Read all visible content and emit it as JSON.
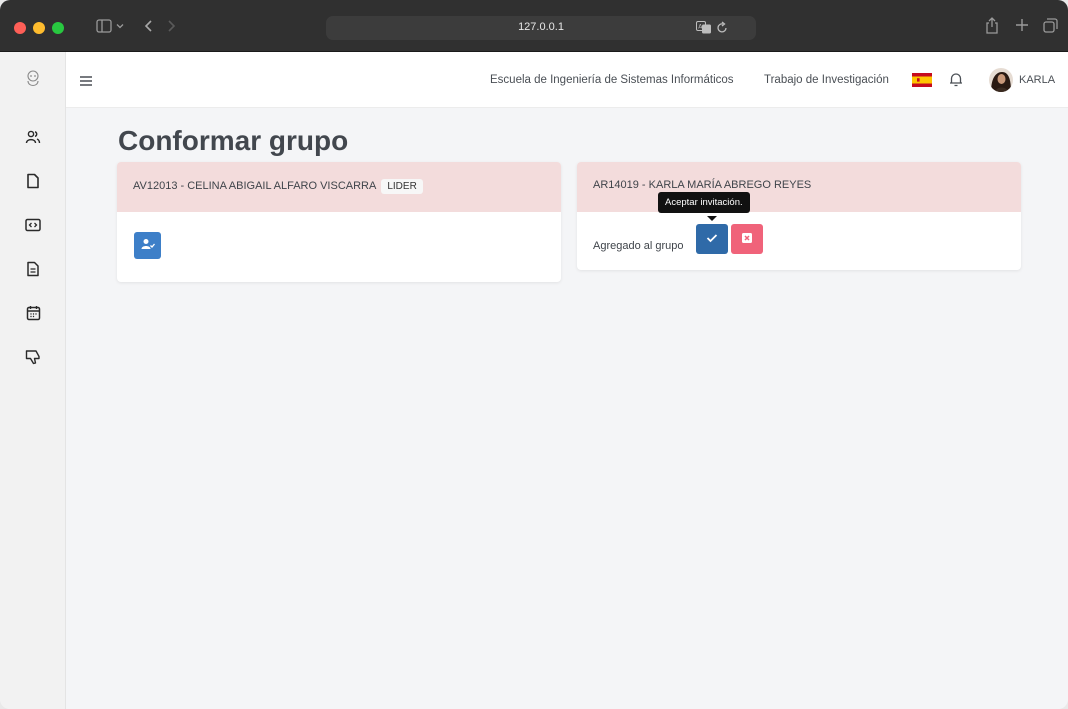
{
  "browser": {
    "url": "127.0.0.1"
  },
  "nav": {
    "links": [
      "Escuela de Ingeniería de Sistemas Informáticos",
      "Trabajo de Investigación"
    ],
    "user_name": "KARLA",
    "language_flag": "spain-flag-icon"
  },
  "sidebar": {
    "items": [
      "users-icon",
      "document-icon",
      "code-icon",
      "file-text-icon",
      "calendar-icon",
      "thumbs-down-icon"
    ]
  },
  "page": {
    "title": "Conformar grupo"
  },
  "cards": [
    {
      "header": "AV12013 - CELINA ABIGAIL ALFARO VISCARRA",
      "badge": "LIDER",
      "action_icon": "user-check-icon"
    },
    {
      "header": "AR14019 - KARLA MARÍA ABREGO REYES",
      "status": "Agregado al grupo",
      "accept_tooltip": "Aceptar invitación.",
      "accept_icon": "check-icon",
      "reject_icon": "x-square-icon"
    }
  ],
  "colors": {
    "primary": "#3d7fc8",
    "danger": "#f0637a",
    "card_header": "#f3dcdc"
  }
}
